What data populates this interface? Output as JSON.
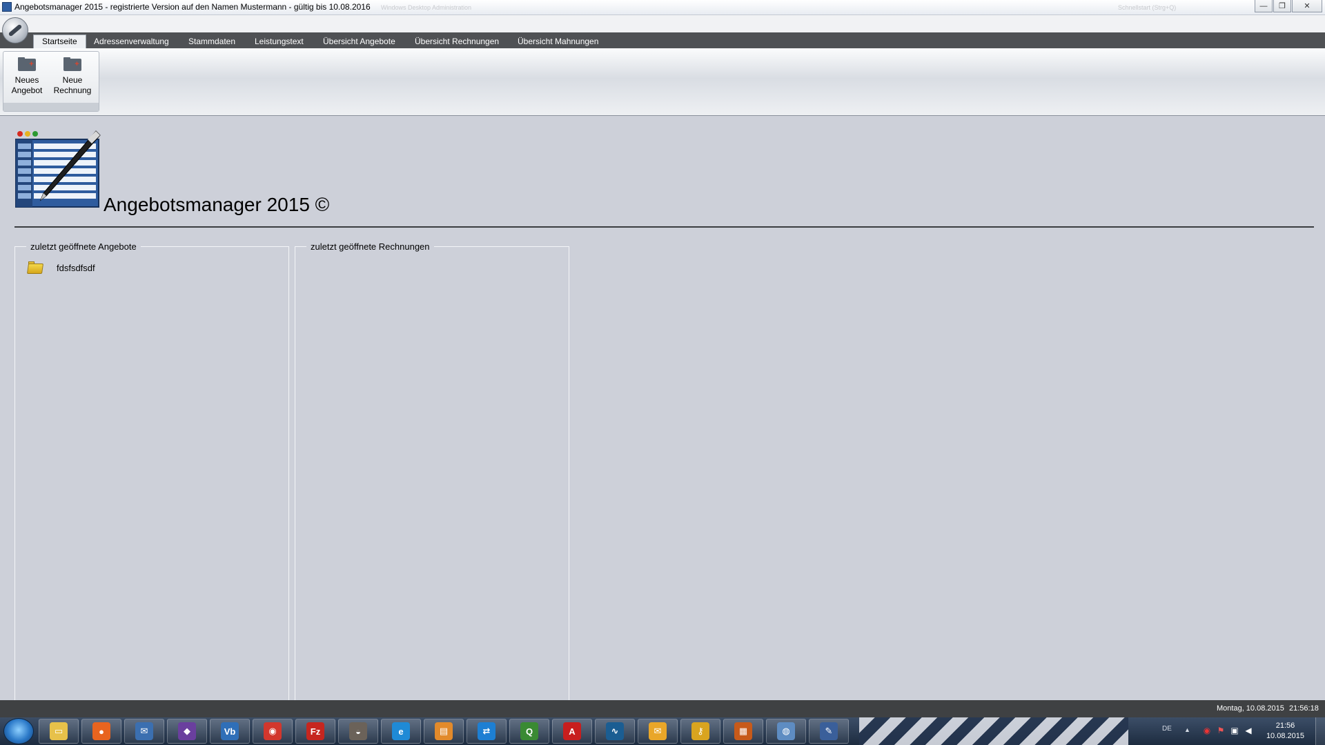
{
  "window": {
    "title": "Angebotsmanager 2015 - registrierte Version auf den Namen Mustermann - gültig bis 10.08.2016",
    "background_titles": [
      "Windows Desktop Administration",
      "Schnellstart (Strg+Q)"
    ],
    "controls": {
      "minimize": "—",
      "maximize": "❐",
      "close": "✕"
    }
  },
  "menu": {
    "tabs": [
      {
        "label": "Startseite",
        "active": true
      },
      {
        "label": "Adressenverwaltung",
        "active": false
      },
      {
        "label": "Stammdaten",
        "active": false
      },
      {
        "label": "Leistungstext",
        "active": false
      },
      {
        "label": "Übersicht Angebote",
        "active": false
      },
      {
        "label": "Übersicht Rechnungen",
        "active": false
      },
      {
        "label": "Übersicht Mahnungen",
        "active": false
      }
    ]
  },
  "ribbon": {
    "buttons": [
      {
        "line1": "Neues",
        "line2": "Angebot",
        "icon": "new-offer-folder-icon"
      },
      {
        "line1": "Neue",
        "line2": "Rechnung",
        "icon": "new-invoice-folder-icon"
      }
    ]
  },
  "main": {
    "app_title": "Angebotsmanager 2015 ©",
    "panels": {
      "angebote": {
        "legend": "zuletzt geöffnete Angebote",
        "items": [
          "fdsfsdfsdf"
        ]
      },
      "rechnungen": {
        "legend": "zuletzt geöffnete Rechnungen",
        "items": []
      }
    }
  },
  "statusbar": {
    "date": "Montag, 10.08.2015",
    "time": "21:56:18"
  },
  "taskbar": {
    "apps": [
      {
        "name": "explorer-icon",
        "glyph": "▭",
        "color": "#e7c14a"
      },
      {
        "name": "firefox-icon",
        "glyph": "●",
        "color": "#e8641f"
      },
      {
        "name": "thunderbird-icon",
        "glyph": "✉",
        "color": "#3b6fb0"
      },
      {
        "name": "visual-studio-icon",
        "glyph": "◆",
        "color": "#6a3f9e"
      },
      {
        "name": "vb-icon",
        "glyph": "Vb",
        "color": "#2f6fb8"
      },
      {
        "name": "chrome-icon",
        "glyph": "◉",
        "color": "#d2372d"
      },
      {
        "name": "filezilla-icon",
        "glyph": "Fz",
        "color": "#c6261f"
      },
      {
        "name": "gimp-icon",
        "glyph": "◒",
        "color": "#6b6259"
      },
      {
        "name": "browser-icon",
        "glyph": "e",
        "color": "#1f8ad6"
      },
      {
        "name": "cards-icon",
        "glyph": "▤",
        "color": "#e28a2b"
      },
      {
        "name": "teamviewer-icon",
        "glyph": "⇄",
        "color": "#1d7fd3"
      },
      {
        "name": "qlik-icon",
        "glyph": "Q",
        "color": "#3a8a33"
      },
      {
        "name": "acrobat-icon",
        "glyph": "A",
        "color": "#c81e1e"
      },
      {
        "name": "monitor-icon",
        "glyph": "∿",
        "color": "#1b5d92"
      },
      {
        "name": "outlook-icon",
        "glyph": "✉",
        "color": "#e9a629"
      },
      {
        "name": "key-icon",
        "glyph": "⚷",
        "color": "#d9a41f"
      },
      {
        "name": "firewall-icon",
        "glyph": "▦",
        "color": "#c75a1a"
      },
      {
        "name": "paint-icon",
        "glyph": "◍",
        "color": "#5e8cc2"
      },
      {
        "name": "angebotsmanager-icon",
        "glyph": "✎",
        "color": "#3a5f9a"
      }
    ],
    "tray": {
      "language": "DE",
      "show_hidden": "▲",
      "clock_time": "21:56",
      "clock_date": "10.08.2015"
    }
  },
  "colors": {
    "menu_bar": "#4f5154",
    "content_bg": "#cdd0d9",
    "statusbar": "#3f4143"
  }
}
